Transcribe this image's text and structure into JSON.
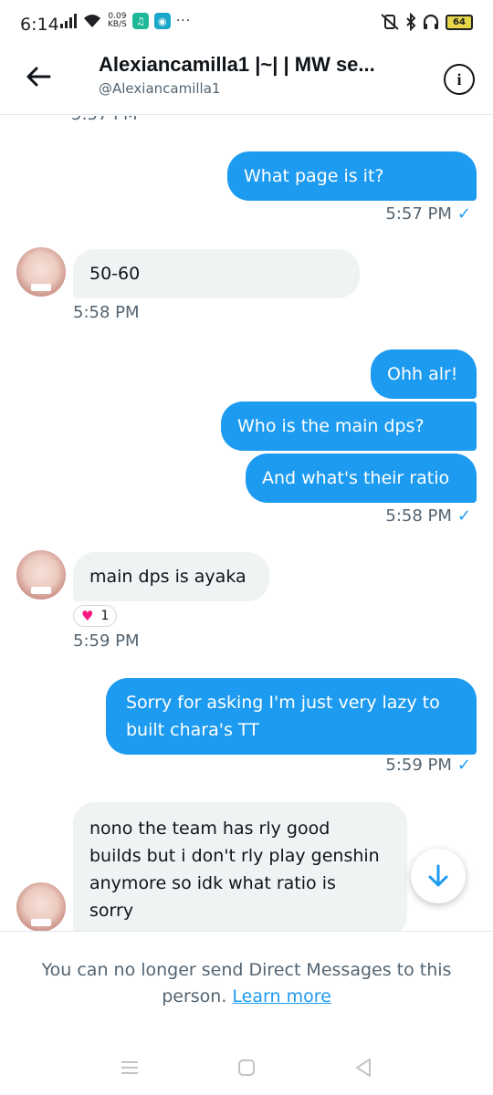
{
  "status_bar": {
    "time": "6:14",
    "speed_value": "0.09",
    "speed_unit": "KB/S",
    "battery": "64"
  },
  "header": {
    "title": "Alexiancamilla1 |~| | MW se...",
    "handle": "@Alexiancamilla1"
  },
  "messages": {
    "cut_time": "5:57 PM",
    "m1": {
      "text": "What page is it?",
      "time": "5:57 PM"
    },
    "m2": {
      "text": "50-60",
      "time": "5:58 PM"
    },
    "m3": {
      "text": "Ohh alr!"
    },
    "m4": {
      "text": "Who is the main dps?"
    },
    "m5": {
      "text": "And what's their ratio",
      "time": "5:58 PM"
    },
    "m6": {
      "text": "main dps is ayaka",
      "reaction_count": "1",
      "time": "5:59 PM"
    },
    "m7": {
      "line1": "Sorry for asking I'm just very lazy to",
      "line2": "built chara's TT",
      "time": "5:59 PM"
    },
    "m8": {
      "line1": "nono the team has rly good",
      "line2": "builds but i don't rly play genshin",
      "line3": "anymore so idk what ratio is",
      "line4": "sorry"
    }
  },
  "footer": {
    "notice_line1": "You can no longer send Direct Messages to this",
    "notice_line2": "person.",
    "learn_more": "Learn more"
  },
  "colors": {
    "accent": "#1d9bf0",
    "incoming_bubble": "#eff3f4",
    "muted_text": "#536471"
  }
}
